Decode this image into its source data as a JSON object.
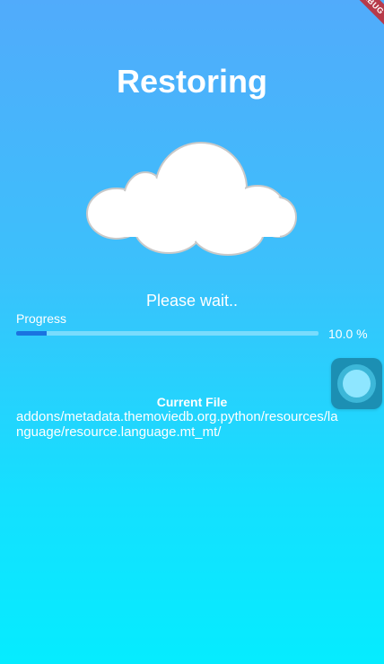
{
  "debug_banner": "DEBUG",
  "title": "Restoring",
  "status_text": "Please wait..",
  "progress": {
    "label": "Progress",
    "fraction": 0.1,
    "value_text": "10.0 %",
    "fill_color": "#1a73e0"
  },
  "current_file": {
    "heading": "Current File",
    "path": "addons/metadata.themoviedb.org.python/resources/language/resource.language.mt_mt/"
  },
  "icons": {
    "cloud": "cloud-icon",
    "floating_button": "assistive-touch-icon"
  },
  "colors": {
    "background_top": "#51abfb",
    "background_bottom": "#05ecff",
    "floating_button": "#1c8fb3"
  }
}
